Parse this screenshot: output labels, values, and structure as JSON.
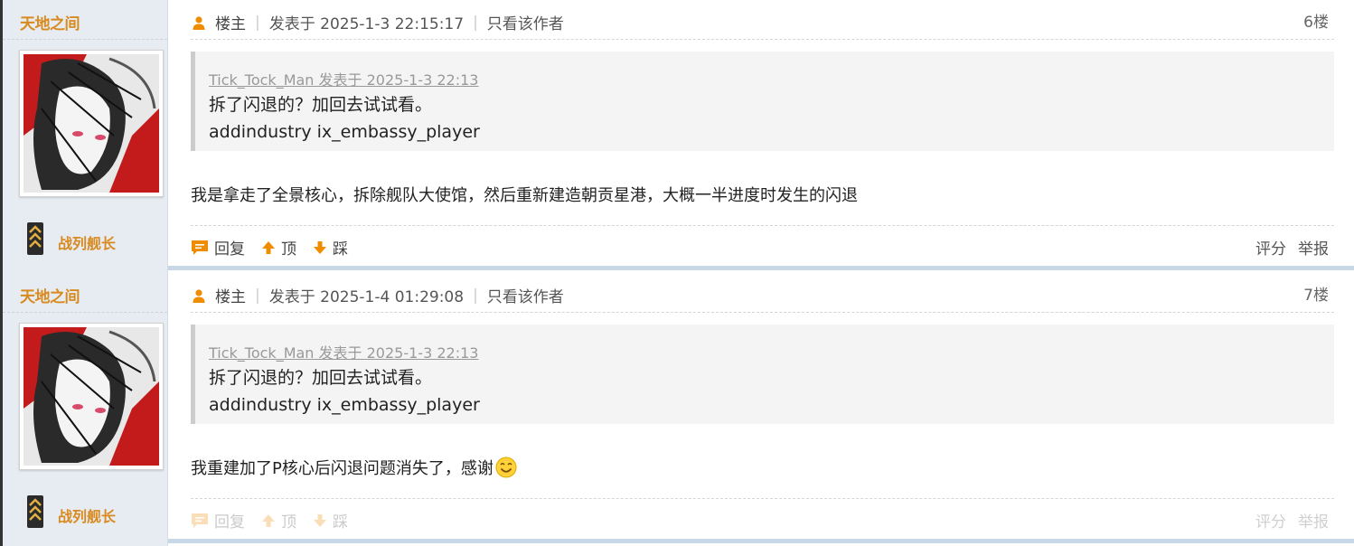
{
  "posts": [
    {
      "username": "天地之间",
      "rank": "战列舰长",
      "role": "楼主",
      "posted": "发表于 2025-1-3 22:15:17",
      "only_author": "只看该作者",
      "floor": "6楼",
      "quote_header": "Tick_Tock_Man 发表于 2025-1-3 22:13",
      "quote_line1": "拆了闪退的？加回去试试看。",
      "quote_line2": "addindustry ix_embassy_player",
      "body": "我是拿走了全景核心，拆除舰队大使馆，然后重新建造朝贡星港，大概一半进度时发生的闪退",
      "reply": "回复",
      "up": "顶",
      "down": "踩",
      "rate": "评分",
      "report": "举报"
    },
    {
      "username": "天地之间",
      "rank": "战列舰长",
      "role": "楼主",
      "posted": "发表于 2025-1-4 01:29:08",
      "only_author": "只看该作者",
      "floor": "7楼",
      "quote_header": "Tick_Tock_Man 发表于 2025-1-3 22:13",
      "quote_line1": "拆了闪退的？加回去试试看。",
      "quote_line2": "addindustry ix_embassy_player",
      "body": "我重建加了P核心后闪退问题消失了，感谢",
      "reply": "回复",
      "up": "顶",
      "down": "踩",
      "rate": "评分",
      "report": "举报"
    }
  ],
  "colors": {
    "accent": "#f08c00",
    "username": "#d98a1f",
    "sidebar": "#e6ecf2",
    "quote_bg": "#f4f4f4"
  },
  "icons": {
    "author": "person-icon",
    "reply": "reply-icon",
    "up": "arrow-up-icon",
    "down": "arrow-down-icon",
    "emoji": "smiley-icon"
  }
}
